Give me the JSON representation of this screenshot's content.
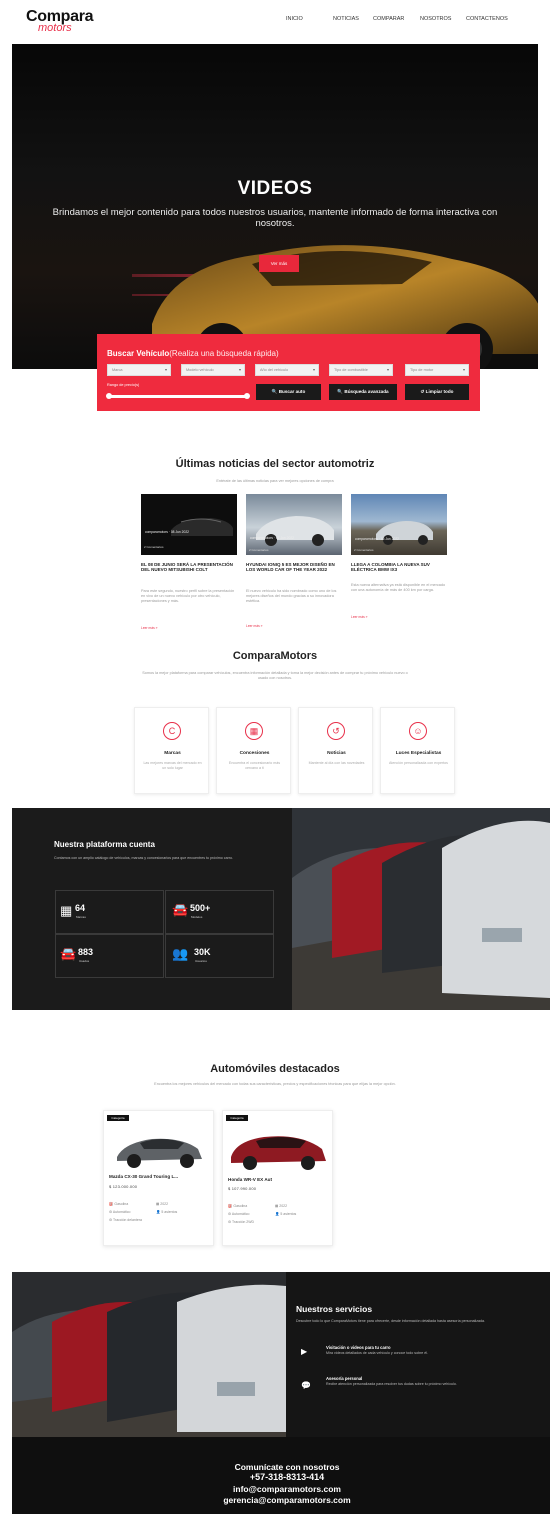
{
  "header": {
    "logo_line1": "Compara",
    "logo_line2": "motors",
    "nav": [
      "INICIO",
      "NOTICIAS",
      "COMPARAR",
      "NOSOTROS",
      "CONTACTENOS"
    ]
  },
  "hero": {
    "title": "VIDEOS",
    "subtitle": "Brindamos el mejor contenido para todos nuestros usuarios, mantente informado de forma interactiva con nosotros.",
    "button": "Ver más"
  },
  "search": {
    "title_bold": "Buscar Vehículo",
    "title_thin": "(Realiza una búsqueda rápida)",
    "selects": [
      "Marca",
      "Modelo vehículo",
      "Año del vehículo",
      "Tipo de combustible",
      "Tipo de motor"
    ],
    "range_label": "Rango de precio(s)",
    "range_min": 0,
    "range_max": 1,
    "buttons": [
      "Buscar auto",
      "Búsqueda avanzada",
      "Limpiar todo"
    ]
  },
  "news": {
    "title": "Últimas noticias del sector automotriz",
    "subtitle": "Entérate de las últimas noticias para ver mejores opciones de compra",
    "items": [
      {
        "meta": "comparamotors  ·  08 Jun 2022",
        "tag": "2 Comentarios",
        "headline": "EL 08 DE JUNIO SERÁ LA PRESENTACIÓN DEL NUEVO MITSUBISHI COLT",
        "body": "Para este segundo, nuestro perfil sobre la presentación en vivo de un nuevo vehículo por otro vehículo, presentaciones y más.",
        "more": "Leer más »"
      },
      {
        "meta": "comparamotors  ·  07 Jun 2022",
        "tag": "2 Comentarios",
        "headline": "HYUNDAI IONIQ 5 ES MEJOR DISEÑO EN LOS WORLD CAR OF THE YEAR 2022",
        "body": "El nuevo vehículo ha sido nombrado como uno de los mejores diseños del mundo gracias a su innovadora estética.",
        "more": "Leer más »"
      },
      {
        "meta": "comparamotors  ·  06 Jun 2022",
        "tag": "2 Comentarios",
        "headline": "LLEGA A COLOMBIA LA NUEVA SUV ELÉCTRICA BMW IX3",
        "body": "Esta nueva alternativa ya está disponible en el mercado con una autonomía de más de 400 km por carga.",
        "more": "Leer más »"
      }
    ]
  },
  "about": {
    "title": "ComparaMotors",
    "text": "Somos la mejor plataforma para comparar vehículos, encuentra información detallada y toma la mejor decisión antes de comprar tu próximo vehículo nuevo o usado con nosotros."
  },
  "features": [
    {
      "icon": "compare-icon",
      "glyph": "C",
      "title": "Marcas",
      "text": "Las mejores marcas del mercado en un solo lugar"
    },
    {
      "icon": "calendar-icon",
      "glyph": "▦",
      "title": "Concesiones",
      "text": "Encuentra el concesionario más cercano a ti"
    },
    {
      "icon": "history-icon",
      "glyph": "↺",
      "title": "Noticias",
      "text": "Mantente al día con las novedades"
    },
    {
      "icon": "team-icon",
      "glyph": "☺",
      "title": "Luces Especialistas",
      "text": "Atención personalizada con expertos"
    }
  ],
  "platform": {
    "title": "Nuestra plataforma cuenta",
    "text": "Contamos con un amplio catálogo de vehículos, marcas y concesionarios para que encuentres tu próximo carro.",
    "stats": [
      {
        "icon": "calendar-icon",
        "glyph": "▦",
        "value": "64",
        "label": "Marcas"
      },
      {
        "icon": "car-icon",
        "glyph": "🚘",
        "value": "500+",
        "label": "Modelos"
      },
      {
        "icon": "car-icon",
        "glyph": "🚘",
        "value": "883",
        "label": "Usados"
      },
      {
        "icon": "users-icon",
        "glyph": "👥",
        "value": "30K",
        "label": "Usuarios"
      }
    ]
  },
  "featured": {
    "title": "Automóviles destacados",
    "subtitle": "Encuentra los mejores vehículos del mercado con todas sus características, precios y especificaciones técnicas para que elijas la mejor opción.",
    "cars": [
      {
        "badge": "Categoría",
        "name": "Mazda CX-30 Grand Touring L...",
        "price": "$ 123.000.000",
        "specs": [
          "Gasolina",
          "2022",
          "Automático",
          "5 asientos",
          "Tracción delantera"
        ]
      },
      {
        "badge": "Categoría",
        "name": "Honda WR-V EX Aut",
        "price": "$ 107.990.000",
        "specs": [
          "Gasolina",
          "2022",
          "Automático",
          "5 asientos",
          "Tracción 2WD"
        ]
      }
    ]
  },
  "services": {
    "title": "Nuestros servicios",
    "text": "Descubre todo lo que ComparaMotors tiene para ofrecerte, desde información detallada hasta asesoría personalizada.",
    "items": [
      {
        "icon": "video-icon",
        "glyph": "▶",
        "title": "Visitación o videos para tu carro",
        "text": "Mira videos detallados de cada vehículo y conoce todo sobre él."
      },
      {
        "icon": "chat-icon",
        "glyph": "💬",
        "title": "Asesoría personal",
        "text": "Recibe atención personalizada para resolver tus dudas sobre tu próximo vehículo."
      }
    ]
  },
  "footer": {
    "title": "Comunícate con nosotros",
    "phone": "+57-318-8313-414",
    "email1": "info@comparamotors.com",
    "email2": "gerencia@comparamotors.com"
  },
  "colors": {
    "accent": "#ef2b3e",
    "dark": "#1b1b1b"
  }
}
